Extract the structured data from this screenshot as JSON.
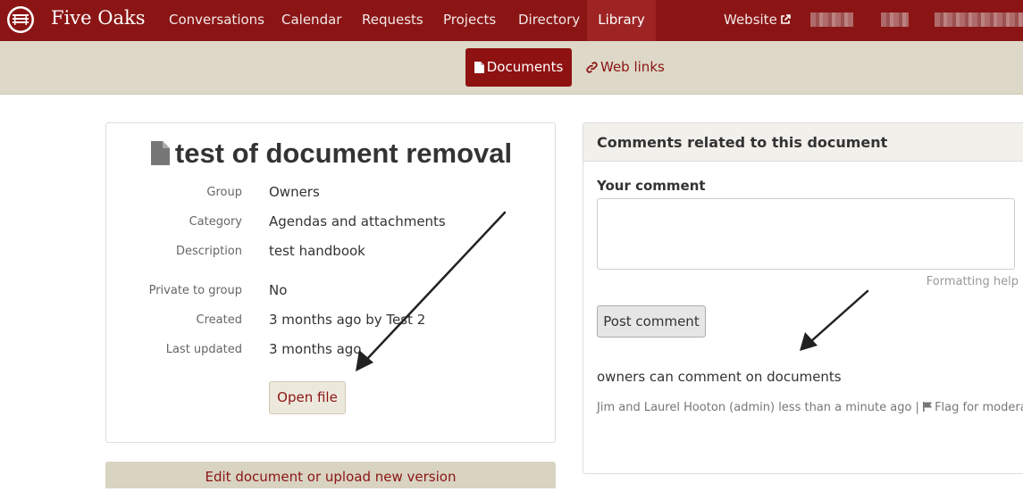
{
  "navbar": {
    "brand": "Five Oaks",
    "items": [
      {
        "label": "Conversations"
      },
      {
        "label": "Calendar"
      },
      {
        "label": "Requests"
      },
      {
        "label": "Projects"
      },
      {
        "label": "Directory"
      },
      {
        "label": "Library",
        "active": true
      }
    ],
    "website_label": "Website",
    "colors": {
      "bar": "#8b1515",
      "active": "#9e2424"
    }
  },
  "subnav": {
    "documents_label": "Documents",
    "weblinks_label": "Web links"
  },
  "document": {
    "title": "test of document removal",
    "fields": [
      {
        "label": "Group",
        "value": "Owners"
      },
      {
        "label": "Category",
        "value": "Agendas and attachments"
      },
      {
        "label": "Description",
        "value": "test handbook"
      },
      {
        "label": "Private to group",
        "value": "No"
      },
      {
        "label": "Created",
        "value": "3 months ago by Test 2"
      },
      {
        "label": "Last updated",
        "value": "3 months ago"
      }
    ],
    "open_file_label": "Open file",
    "edit_label": "Edit document or upload new version"
  },
  "comments": {
    "header": "Comments related to this document",
    "your_comment_label": "Your comment",
    "textarea_value": "",
    "formatting_help": "Formatting help",
    "post_label": "Post comment",
    "items": [
      {
        "body": "owners can comment on documents",
        "meta": "Jim and Laurel Hooton (admin) less than a minute ago | ",
        "flag_label": "Flag for moderation"
      }
    ]
  }
}
